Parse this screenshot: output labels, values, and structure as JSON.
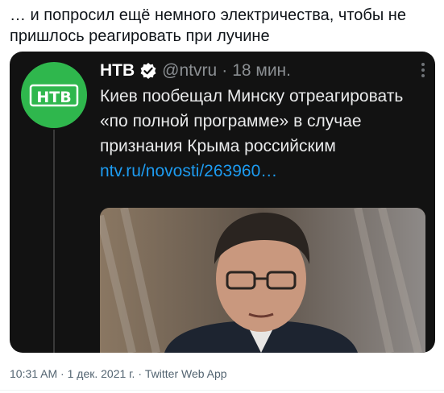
{
  "tweet": {
    "text": "… и попросил ещё немного электричества, чтобы не пришлось реагировать при лучине",
    "timestamp": "10:31 AM · 1 дек. 2021 г. · Twitter Web App"
  },
  "embedded_post": {
    "name": "НТВ",
    "handle": "@ntvru",
    "separator": "·",
    "time": "18 мин.",
    "text_plain": "Киев пообещал Минску отреагировать «по полной программе» в случае признания Крыма российским ",
    "text_link": "ntv.ru/novosti/263960…",
    "avatar_logo_text": "НТВ",
    "icons": [
      "ntv-logo-icon",
      "verified-badge-icon",
      "more-icon"
    ],
    "colors": {
      "avatar_bg": "#2fb74d",
      "link": "#1d9bf0",
      "card_bg": "#121212"
    }
  }
}
